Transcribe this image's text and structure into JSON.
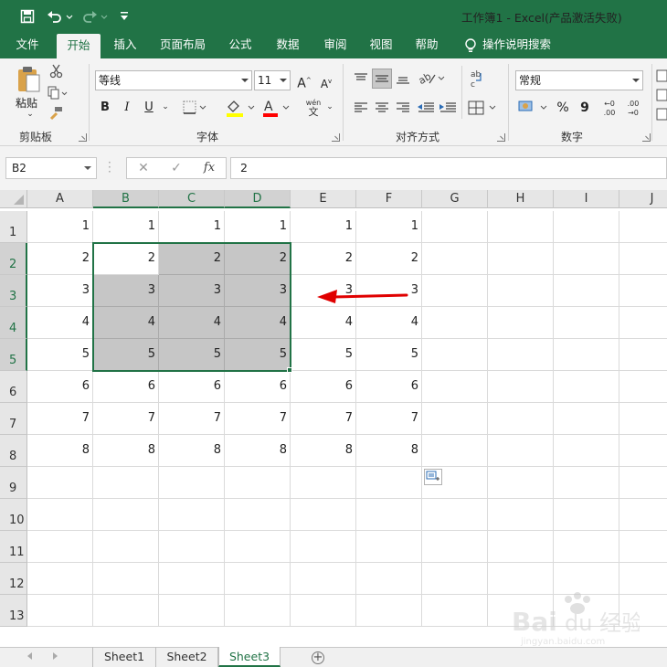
{
  "window": {
    "title": "工作簿1  -  Excel(产品激活失败)"
  },
  "menu": {
    "tabs": [
      {
        "label": "文件",
        "active": false
      },
      {
        "label": "开始",
        "active": true
      },
      {
        "label": "插入",
        "active": false
      },
      {
        "label": "页面布局",
        "active": false
      },
      {
        "label": "公式",
        "active": false
      },
      {
        "label": "数据",
        "active": false
      },
      {
        "label": "审阅",
        "active": false
      },
      {
        "label": "视图",
        "active": false
      },
      {
        "label": "帮助",
        "active": false
      }
    ],
    "tell_me": "操作说明搜索"
  },
  "ribbon": {
    "clipboard": {
      "paste_label": "粘贴",
      "group_label": "剪贴板"
    },
    "font": {
      "font_name": "等线",
      "font_size": "11",
      "group_label": "字体",
      "bold": "B",
      "italic": "I",
      "underline": "U",
      "grow": "A",
      "shrink": "A",
      "phonetic_top": "wén",
      "phonetic_bottom": "文",
      "fill_color": "#ffff00",
      "font_color": "#ff0000"
    },
    "alignment": {
      "group_label": "对齐方式"
    },
    "number": {
      "format": "常规",
      "group_label": "数字",
      "percent": "%",
      "comma": "9",
      "inc_decimal_top": "←0",
      "inc_decimal_bottom": ".00",
      "dec_decimal_top": ".00",
      "dec_decimal_bottom": "→0"
    }
  },
  "formula_bar": {
    "name_box": "B2",
    "formula": "2",
    "fx": "fx"
  },
  "grid": {
    "columns": [
      "A",
      "B",
      "C",
      "D",
      "E",
      "F",
      "G",
      "H",
      "I",
      "J"
    ],
    "selected_columns": [
      "B",
      "C",
      "D"
    ],
    "rows": [
      "1",
      "2",
      "3",
      "4",
      "5",
      "6",
      "7",
      "8",
      "9",
      "10",
      "11",
      "12",
      "13"
    ],
    "selected_rows": [
      "2",
      "3",
      "4",
      "5"
    ],
    "cells": [
      [
        "1",
        "1",
        "1",
        "1",
        "1",
        "1"
      ],
      [
        "2",
        "2",
        "2",
        "2",
        "2",
        "2"
      ],
      [
        "3",
        "3",
        "3",
        "3",
        "3",
        "3"
      ],
      [
        "4",
        "4",
        "4",
        "4",
        "4",
        "4"
      ],
      [
        "5",
        "5",
        "5",
        "5",
        "5",
        "5"
      ],
      [
        "6",
        "6",
        "6",
        "6",
        "6",
        "6"
      ],
      [
        "7",
        "7",
        "7",
        "7",
        "7",
        "7"
      ],
      [
        "8",
        "8",
        "8",
        "8",
        "8",
        "8"
      ]
    ],
    "selection": "B2:D5",
    "active_cell": "B2",
    "annotation_arrow_color": "#e00000",
    "accent_color": "#217346"
  },
  "sheets": {
    "tabs": [
      {
        "label": "Sheet1",
        "active": false
      },
      {
        "label": "Sheet2",
        "active": false
      },
      {
        "label": "Sheet3",
        "active": true
      }
    ]
  },
  "watermark": {
    "text": "Bai 经验",
    "subtext": "jingyan.baidu.com"
  }
}
